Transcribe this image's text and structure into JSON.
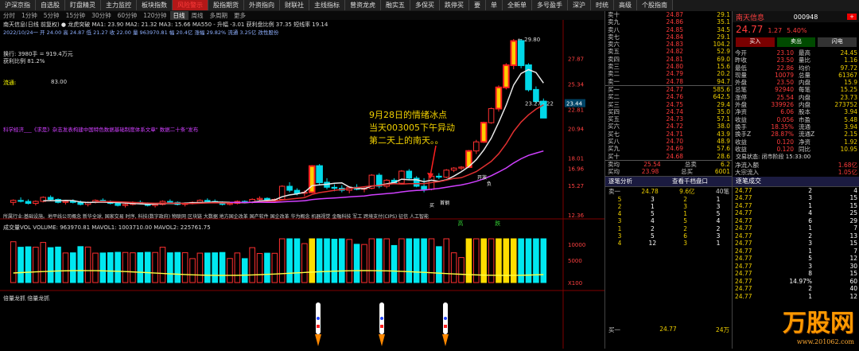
{
  "topbar": [
    "沪深京指",
    "自选股",
    "盯盘精灵",
    "主力监控",
    "板块指数",
    "风险警示",
    "股指期货",
    "外资指向",
    "财联社",
    "主线指标",
    "曾资龙虎",
    "融实五",
    "多保买",
    "跌停买",
    "要",
    "单",
    "全新单",
    "多号盈手",
    "深沪",
    "时统",
    "高级",
    "个股指南"
  ],
  "periods": [
    "分时",
    "1分钟",
    "5分钟",
    "15分钟",
    "30分钟",
    "60分钟",
    "120分钟",
    "日线",
    "周线",
    "多周期",
    "更多"
  ],
  "active_period": "日线",
  "stock": {
    "title_line": "南天信息(日线 前复权) ● 龙虎突破 MA1: 23.90  MA2: 21.32  MA3: 15.66  MA550  - 升幅 -3.01  获利盘比例 37.35  短线率 19.14",
    "info_line": "2022/10/24一 开 24.00 高 24.87 低 21.27 收 22.00 量 963970.81 幅 20.4亿 涨幅 29.82% 流通 3.25亿 改性股份",
    "float_text": "换行: 3980手 = 919.4万元",
    "profit_text": "获利比例 81.2%",
    "liutong": "流通:",
    "liutong_val": "83.00",
    "news": "科学经济___《求是》杂志发表构建中国特色数据基础制度体系文章\" 数据二十条\"发布",
    "sectors": "所属行业:基础设施。地平线公司概念 新华全球, 国家交易 时序, 科技(数字政府) 物联网 区块链 大数据 地方国企改革 国产软件 国企改革 华为概念 机器视觉 金融科技 军工 跨境支付(CIPS) 征信 人工智能 ",
    "tag_left": "高",
    "tag_right": "跌",
    "price_axis": [
      "27.87",
      "25.34",
      "22.81",
      "20.94",
      "18.01",
      "16.96",
      "15.27",
      "12.36"
    ],
    "peak_label": "29.80",
    "cursor_label": "23.44",
    "range_label": "23.27 - 22",
    "vol_line": "成交量VOL VOLUME: 963970.81  MAVOL1: 1003710.00  MAVOL2: 225761.75",
    "vol_axis": [
      "10000",
      "5000",
      "X100"
    ],
    "rocket_line": "倍量龙抓  倍量龙抓",
    "annotation": [
      "9月28日的情绪冰点",
      "当天003005下午异动",
      "第二天上的南天。。"
    ],
    "small_tags": [
      "买",
      "首钢",
      "开放",
      "负"
    ],
    "watermark": "万股网",
    "watermark_url": "www.201062.com"
  },
  "chart_data": {
    "type": "candlestick",
    "title": "南天信息(日线 前复权)",
    "ylim": [
      12.36,
      29.8
    ],
    "candles_ohlc": [
      [
        13.6,
        13.9,
        13.3,
        13.8
      ],
      [
        13.8,
        14.1,
        13.6,
        13.7
      ],
      [
        13.7,
        13.9,
        13.4,
        13.5
      ],
      [
        13.5,
        13.8,
        13.3,
        13.7
      ],
      [
        13.7,
        14.2,
        13.6,
        14.1
      ],
      [
        14.1,
        14.3,
        13.8,
        13.9
      ],
      [
        13.9,
        14.0,
        13.5,
        13.6
      ],
      [
        13.6,
        13.8,
        13.4,
        13.7
      ],
      [
        13.7,
        13.9,
        13.5,
        13.6
      ],
      [
        13.6,
        13.8,
        13.3,
        13.4
      ],
      [
        13.4,
        13.7,
        13.2,
        13.6
      ],
      [
        13.6,
        13.9,
        13.5,
        13.8
      ],
      [
        13.8,
        14.0,
        13.6,
        13.7
      ],
      [
        13.7,
        13.8,
        13.4,
        13.5
      ],
      [
        13.5,
        13.6,
        13.2,
        13.3
      ],
      [
        13.3,
        13.5,
        13.1,
        13.4
      ],
      [
        13.4,
        13.7,
        13.3,
        13.6
      ],
      [
        13.6,
        13.8,
        13.4,
        13.5
      ],
      [
        13.5,
        13.6,
        13.2,
        13.3
      ],
      [
        13.3,
        13.5,
        13.1,
        13.4
      ],
      [
        13.4,
        13.8,
        13.3,
        13.7
      ],
      [
        13.7,
        13.9,
        13.5,
        13.6
      ],
      [
        13.6,
        13.7,
        13.3,
        13.4
      ],
      [
        13.4,
        13.6,
        13.2,
        13.5
      ],
      [
        13.5,
        13.7,
        13.4,
        13.6
      ],
      [
        13.6,
        13.9,
        13.5,
        13.8
      ],
      [
        13.8,
        14.0,
        13.6,
        13.7
      ],
      [
        13.7,
        13.9,
        13.5,
        13.6
      ],
      [
        13.6,
        13.7,
        13.3,
        13.4
      ],
      [
        13.4,
        13.6,
        13.3,
        13.5
      ],
      [
        13.5,
        13.8,
        13.4,
        13.7
      ],
      [
        13.7,
        13.8,
        13.5,
        13.6
      ],
      [
        13.6,
        14.0,
        13.5,
        13.9
      ],
      [
        13.9,
        14.2,
        13.8,
        14.0
      ],
      [
        14.0,
        14.1,
        13.7,
        13.8
      ],
      [
        13.8,
        14.0,
        13.6,
        13.9
      ],
      [
        13.9,
        15.3,
        13.8,
        15.2
      ],
      [
        15.2,
        15.6,
        14.6,
        14.8
      ],
      [
        14.8,
        15.0,
        14.3,
        14.5
      ],
      [
        14.5,
        14.8,
        14.2,
        14.6
      ],
      [
        14.6,
        17.3,
        14.5,
        17.2
      ],
      [
        17.2,
        17.4,
        15.4,
        15.6
      ],
      [
        15.6,
        16.0,
        14.9,
        15.1
      ],
      [
        15.1,
        15.4,
        14.7,
        15.0
      ],
      [
        15.0,
        15.3,
        14.6,
        14.8
      ],
      [
        14.8,
        15.2,
        14.5,
        15.1
      ],
      [
        15.1,
        15.4,
        14.8,
        14.9
      ],
      [
        14.9,
        15.2,
        14.6,
        15.0
      ],
      [
        15.0,
        16.4,
        14.9,
        16.3
      ],
      [
        16.3,
        16.5,
        15.0,
        15.2
      ],
      [
        15.2,
        15.9,
        15.0,
        15.8
      ],
      [
        15.8,
        16.0,
        15.4,
        15.5
      ],
      [
        15.5,
        16.8,
        15.4,
        16.7
      ],
      [
        16.7,
        16.9,
        15.8,
        16.0
      ],
      [
        16.0,
        16.2,
        15.1,
        15.2
      ],
      [
        15.2,
        16.0,
        14.6,
        14.9
      ],
      [
        14.9,
        16.3,
        14.8,
        16.2
      ],
      [
        16.2,
        16.5,
        15.9,
        16.1
      ],
      [
        16.1,
        16.9,
        16.0,
        16.8
      ],
      [
        16.8,
        17.1,
        16.6,
        17.0
      ],
      [
        17.0,
        17.2,
        16.8,
        17.1
      ],
      [
        17.1,
        18.8,
        17.0,
        18.7
      ],
      [
        18.7,
        19.8,
        18.4,
        19.6
      ],
      [
        19.6,
        21.6,
        19.5,
        21.5
      ],
      [
        21.5,
        23.0,
        21.4,
        22.9
      ],
      [
        22.9,
        25.2,
        22.6,
        25.0
      ],
      [
        25.0,
        27.4,
        24.8,
        27.2
      ],
      [
        27.2,
        29.8,
        26.8,
        29.6
      ],
      [
        29.6,
        29.8,
        26.9,
        27.2
      ],
      [
        27.2,
        27.4,
        24.6,
        24.8
      ],
      [
        24.8,
        25.1,
        23.4,
        23.6
      ],
      [
        23.6,
        23.9,
        22.0,
        22.0
      ]
    ]
  },
  "orderbook": {
    "sell": [
      {
        "label": "卖十",
        "price": "24.87",
        "vol": "29.1"
      },
      {
        "label": "卖九",
        "price": "24.86",
        "vol": "35.1"
      },
      {
        "label": "卖八",
        "price": "24.85",
        "vol": "34.5"
      },
      {
        "label": "卖七",
        "price": "24.84",
        "vol": "29.1"
      },
      {
        "label": "卖六",
        "price": "24.83",
        "vol": "104.2"
      },
      {
        "label": "卖五",
        "price": "24.82",
        "vol": "52.9"
      },
      {
        "label": "卖四",
        "price": "24.81",
        "vol": "69.0"
      },
      {
        "label": "卖三",
        "price": "24.80",
        "vol": "15.6"
      },
      {
        "label": "卖二",
        "price": "24.79",
        "vol": "20.2"
      },
      {
        "label": "卖一",
        "price": "24.78",
        "vol": "94.7"
      }
    ],
    "buy": [
      {
        "label": "买一",
        "price": "24.77",
        "vol": "585.6"
      },
      {
        "label": "买二",
        "price": "24.76",
        "vol": "642.5"
      },
      {
        "label": "买三",
        "price": "24.75",
        "vol": "29.4"
      },
      {
        "label": "买四",
        "price": "24.74",
        "vol": "35.0"
      },
      {
        "label": "买五",
        "price": "24.73",
        "vol": "57.1"
      },
      {
        "label": "买六",
        "price": "24.72",
        "vol": "38.0"
      },
      {
        "label": "买七",
        "price": "24.71",
        "vol": "43.9"
      },
      {
        "label": "买八",
        "price": "24.70",
        "vol": "48.9"
      },
      {
        "label": "买九",
        "price": "24.69",
        "vol": "57.6"
      },
      {
        "label": "买十",
        "price": "24.68",
        "vol": "28.6"
      }
    ],
    "summary": [
      {
        "label": "卖均",
        "price": "25.54",
        "extra": "总卖",
        "vol": "6.2"
      },
      {
        "label": "买均",
        "price": "23.98",
        "extra": "总买",
        "vol": "6001"
      }
    ],
    "panel_title_a": "逐笔分析",
    "panel_title_b": "查看千档盘口",
    "sub_head": [
      "卖一",
      "24.78",
      "9.6亿",
      "40笔"
    ],
    "tick_rows": [
      [
        "5",
        "3",
        "2",
        "1"
      ],
      [
        "2",
        "1",
        "3",
        "3"
      ],
      [
        "4",
        "5",
        "1",
        "5"
      ],
      [
        "3",
        "4",
        "5",
        "4"
      ],
      [
        "1",
        "2",
        "2",
        "2"
      ],
      [
        "3",
        "5",
        "6",
        "3"
      ],
      [
        "4",
        "12",
        "3",
        "1"
      ]
    ],
    "bottom_label": "买一",
    "bottom_price": "24.77",
    "bottom_vol": "24万"
  },
  "quote": {
    "name": "南天信息",
    "code": "000948",
    "price": "24.77",
    "change": "1.27",
    "pct": "5.40%",
    "btns": [
      "买入",
      "卖出",
      "闪电"
    ],
    "fields": [
      [
        "今开",
        "23.10",
        "最高",
        "24.45"
      ],
      [
        "昨收",
        "23.50",
        "量比",
        "1.16"
      ],
      [
        "最低",
        "22.86",
        "均价",
        "97.72"
      ],
      [
        "现量",
        "10079",
        "总量",
        "61367"
      ],
      [
        "外盘",
        "23.50",
        "内盘",
        "15.9"
      ],
      [
        "总笔",
        "92940",
        "每笔",
        "15.25"
      ],
      [
        "涨停",
        "25.54",
        "内盘",
        "23.73"
      ],
      [
        "外盘",
        "339926",
        "内盘",
        "273752"
      ],
      [
        "净资",
        "6.06",
        "股本",
        "3.94"
      ],
      [
        "收益",
        "0.056",
        "市盈",
        "5.48"
      ],
      [
        "换手",
        "18.35%",
        "流通",
        "3.94"
      ],
      [
        "换手Z",
        "28.87%",
        "流通Z",
        "2.15"
      ],
      [
        "收益",
        "0.120",
        "净资",
        "1.92"
      ],
      [
        "收益",
        "0.120",
        "同比",
        "10.95"
      ]
    ],
    "status": "交易状态: 闭市阶段 15:33:00",
    "flow": [
      [
        "净流入额",
        "1.68亿"
      ],
      [
        "大宗流入",
        "1.05亿"
      ]
    ],
    "trade_title": "逐笔成交",
    "trades": [
      [
        "24.77",
        "2",
        "4"
      ],
      [
        "24.77",
        "3",
        "15"
      ],
      [
        "24.77",
        "1",
        "15"
      ],
      [
        "24.77",
        "4",
        "25"
      ],
      [
        "24.77",
        "6",
        "29"
      ],
      [
        "24.77",
        "1",
        "7"
      ],
      [
        "24.77",
        "2",
        "13"
      ],
      [
        "24.77",
        "3",
        "15"
      ],
      [
        "24.77",
        "1",
        "7"
      ],
      [
        "24.77",
        "5",
        "12"
      ],
      [
        "24.77",
        "3",
        "30"
      ],
      [
        "24.77",
        "8",
        "15"
      ],
      [
        "24.77",
        "14.97%",
        "60"
      ],
      [
        "24.77",
        "2",
        "40"
      ],
      [
        "24.77",
        "1",
        "12"
      ]
    ]
  }
}
